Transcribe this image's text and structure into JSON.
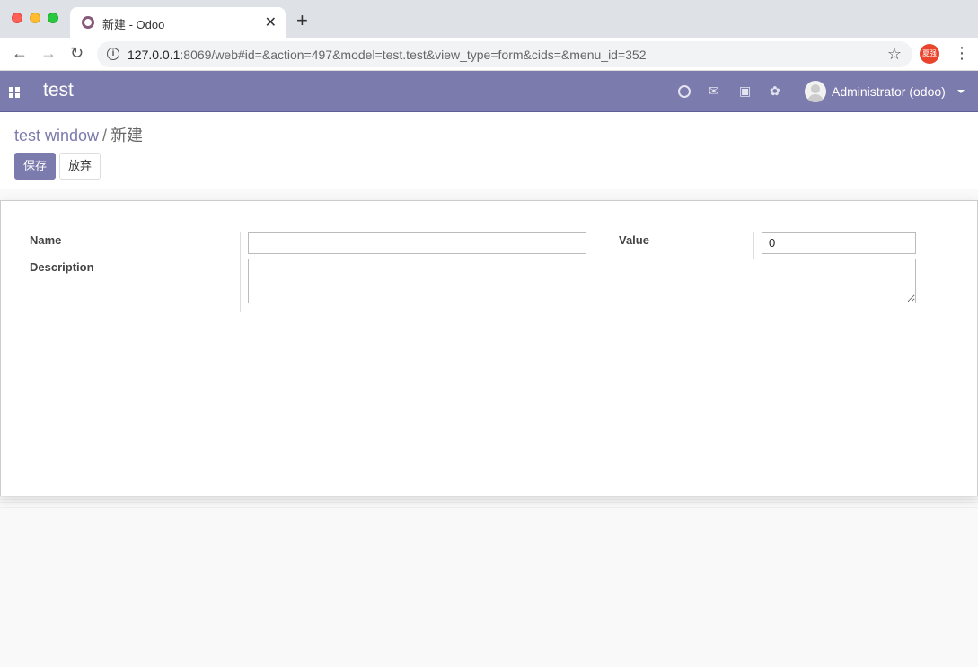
{
  "browser": {
    "tab_title": "新建 - Odoo",
    "tab_close": "✕",
    "new_tab": "+",
    "url_host": "127.0.0.1",
    "url_rest": ":8069/web#id=&action=497&model=test.test&view_type=form&cids=&menu_id=352",
    "profile_label": "夏强"
  },
  "navbar": {
    "brand": "test",
    "user_name": "Administrator (odoo)"
  },
  "breadcrumb": {
    "parent": "test window",
    "separator": "/",
    "current": "新建"
  },
  "buttons": {
    "save": "保存",
    "discard": "放弃"
  },
  "form": {
    "name_label": "Name",
    "name_value": "",
    "description_label": "Description",
    "description_value": "",
    "value_label": "Value",
    "value_value": "0"
  },
  "colors": {
    "brand": "#7c7bad",
    "favicon": "#875a7b"
  },
  "icons": [
    "apps-icon",
    "clock-icon",
    "chat-icon",
    "gift-icon",
    "bug-icon",
    "star-icon",
    "info-icon"
  ]
}
